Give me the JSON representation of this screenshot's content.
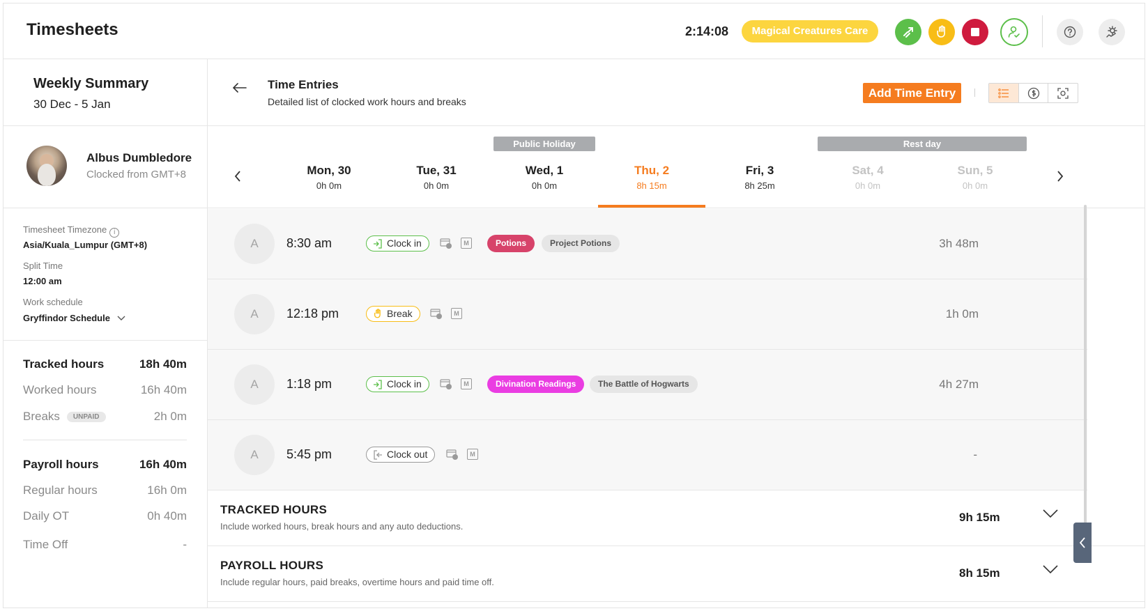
{
  "header": {
    "title": "Timesheets",
    "timer": "2:14:08",
    "project": "Magical Creatures Care",
    "icons": [
      "switch-project-icon",
      "break-icon",
      "stop-icon",
      "member-status-icon",
      "help-icon",
      "settings-icon"
    ]
  },
  "summary": {
    "title": "Weekly Summary",
    "range": "30 Dec - 5 Jan"
  },
  "user": {
    "name": "Albus Dumbledore",
    "clocked_from": "Clocked from GMT+8"
  },
  "settings": {
    "timezone_label": "Timesheet Timezone",
    "timezone_value": "Asia/Kuala_Lumpur (GMT+8)",
    "split_label": "Split Time",
    "split_value": "12:00 am",
    "schedule_label": "Work schedule",
    "schedule_value": "Gryffindor Schedule"
  },
  "hours": {
    "tracked_label": "Tracked hours",
    "tracked_value": "18h 40m",
    "worked_label": "Worked hours",
    "worked_value": "16h 40m",
    "breaks_label": "Breaks",
    "breaks_badge": "UNPAID",
    "breaks_value": "2h 0m",
    "payroll_label": "Payroll hours",
    "payroll_value": "16h 40m",
    "regular_label": "Regular hours",
    "regular_value": "16h 0m",
    "daily_ot_label": "Daily OT",
    "daily_ot_value": "0h 40m",
    "time_off_label": "Time Off",
    "time_off_value": "-"
  },
  "main": {
    "title": "Time Entries",
    "subtitle": "Detailed list of clocked work hours and breaks",
    "add_button": "Add Time Entry"
  },
  "days": {
    "public_holiday": "Public Holiday",
    "rest_day": "Rest day",
    "items": [
      {
        "name": "Mon, 30",
        "hours": "0h 0m"
      },
      {
        "name": "Tue, 31",
        "hours": "0h 0m"
      },
      {
        "name": "Wed, 1",
        "hours": "0h 0m"
      },
      {
        "name": "Thu, 2",
        "hours": "8h 15m"
      },
      {
        "name": "Fri, 3",
        "hours": "8h 25m"
      },
      {
        "name": "Sat, 4",
        "hours": "0h 0m"
      },
      {
        "name": "Sun, 5",
        "hours": "0h 0m"
      }
    ],
    "selected": "Thu, 2"
  },
  "entries": [
    {
      "avatar": "A",
      "time": "8:30 am",
      "type": "Clock in",
      "tag": "Potions",
      "project": "Project Potions",
      "duration": "3h 48m",
      "m": "M"
    },
    {
      "avatar": "A",
      "time": "12:18 pm",
      "type": "Break",
      "duration": "1h 0m",
      "m": "M"
    },
    {
      "avatar": "A",
      "time": "1:18 pm",
      "type": "Clock in",
      "tag": "Divination Readings",
      "project": "The Battle of Hogwarts",
      "duration": "4h 27m",
      "m": "M"
    },
    {
      "avatar": "A",
      "time": "5:45 pm",
      "type": "Clock out",
      "duration": "-",
      "m": "M"
    }
  ],
  "totals": {
    "tracked_title": "TRACKED HOURS",
    "tracked_sub": "Include worked hours, break hours and any auto deductions.",
    "tracked_value": "9h 15m",
    "payroll_title": "PAYROLL HOURS",
    "payroll_sub": "Include regular hours, paid breaks, overtime hours and paid time off.",
    "payroll_value": "8h 15m"
  },
  "colors": {
    "accent": "#f57c1f",
    "project_chip": "#fcd53f",
    "green": "#5cbf4a",
    "yellow": "#f8bd16",
    "red": "#cf1b3e",
    "potions_tag": "#d7436a",
    "divination_tag": "#ea3de2"
  }
}
